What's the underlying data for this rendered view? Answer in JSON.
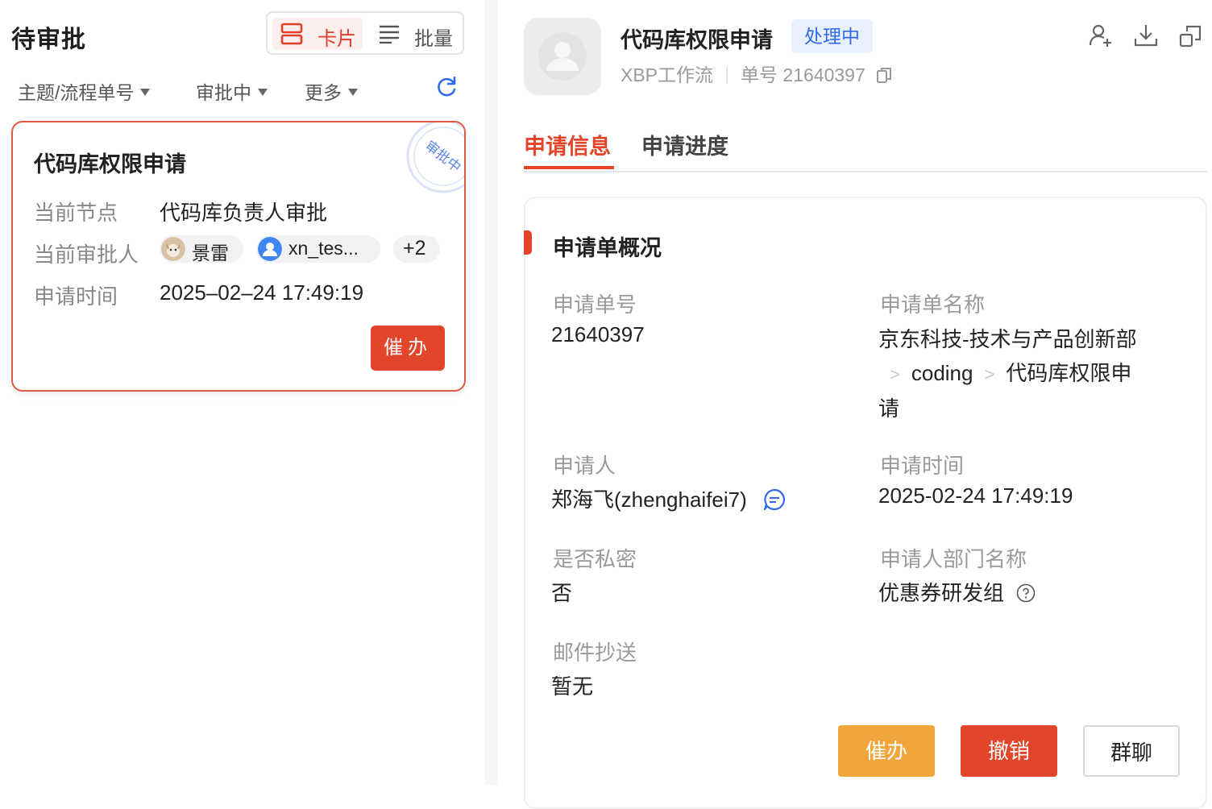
{
  "left": {
    "title": "待审批",
    "view_toggle": {
      "card_label": "卡片",
      "batch_label": "批量"
    },
    "filters": [
      "主题/流程单号",
      "审批中",
      "更多"
    ],
    "card": {
      "title": "代码库权限申请",
      "stamp_text": "审批中",
      "node_label": "当前节点",
      "node_value": "代码库负责人审批",
      "approver_label": "当前审批人",
      "approvers": [
        "景雷",
        "xn_tes..."
      ],
      "approvers_more": "+2",
      "time_label": "申请时间",
      "time_value": "2025–02–24 17:49:19",
      "urge_label": "催办"
    }
  },
  "right": {
    "title": "代码库权限申请",
    "status": "处理中",
    "workflow": "XBP工作流",
    "order_prefix": "单号",
    "order_no": "21640397",
    "tabs": [
      "申请信息",
      "申请进度"
    ],
    "section_title": "申请单概况",
    "fields": {
      "order_no_label": "申请单号",
      "order_no_value": "21640397",
      "name_label": "申请单名称",
      "name_line1": "京东科技-技术与产品创新部",
      "name_crumb_a": "coding",
      "name_crumb_b": "代码库权限申",
      "name_line3": "请",
      "crumb_sep": ">",
      "applicant_label": "申请人",
      "applicant_value": "郑海飞(zhenghaifei7)",
      "apply_time_label": "申请时间",
      "apply_time_value": "2025-02-24 17:49:19",
      "private_label": "是否私密",
      "private_value": "否",
      "dept_label": "申请人部门名称",
      "dept_value": "优惠券研发组",
      "mail_label": "邮件抄送",
      "mail_value": "暂无"
    },
    "buttons": {
      "urge": "催办",
      "revoke": "撤销",
      "group_chat": "群聊"
    }
  },
  "icons": [
    "card-view-icon",
    "list-view-icon",
    "dropdown-arrow-icon",
    "refresh-icon",
    "add-user-icon",
    "download-icon",
    "open-window-icon",
    "copy-icon",
    "chat-icon",
    "help-icon"
  ],
  "colors": {
    "accent": "#e2452a",
    "status_blue": "#2f6bea",
    "urge_orange": "#f2a53c"
  }
}
